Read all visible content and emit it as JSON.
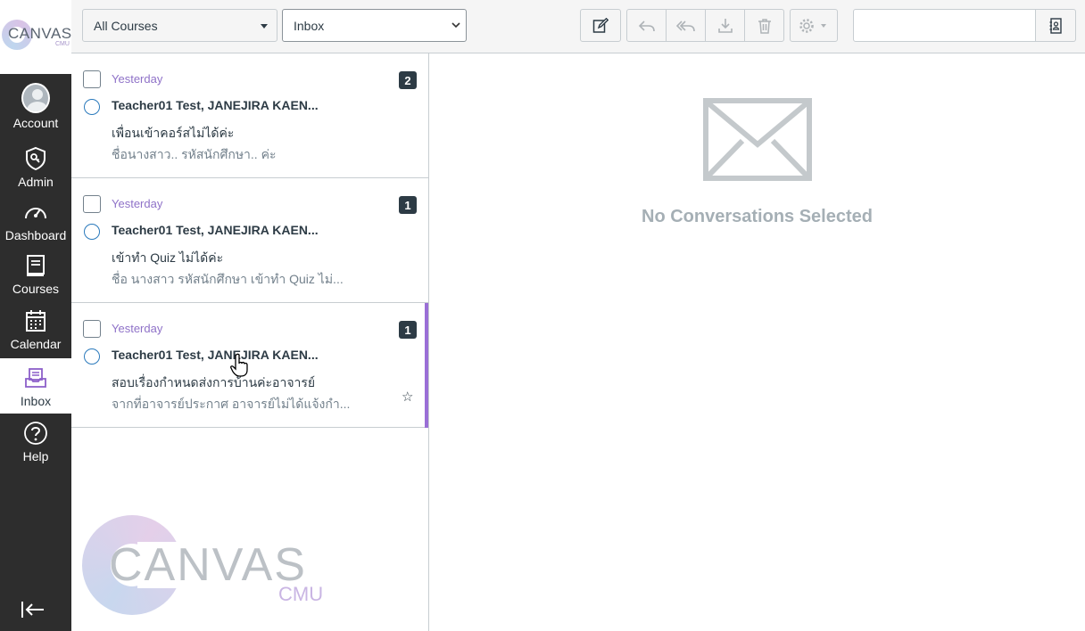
{
  "brand": {
    "logo_text": "CANVAS",
    "logo_sub": "CMU"
  },
  "global_nav": {
    "items": [
      {
        "label": "Account",
        "icon": "avatar"
      },
      {
        "label": "Admin",
        "icon": "shield-icon"
      },
      {
        "label": "Dashboard",
        "icon": "speedometer-icon"
      },
      {
        "label": "Courses",
        "icon": "book-icon"
      },
      {
        "label": "Calendar",
        "icon": "calendar-icon"
      },
      {
        "label": "Inbox",
        "icon": "inbox-icon",
        "active": true
      },
      {
        "label": "Help",
        "icon": "help-icon"
      }
    ],
    "collapse_icon": "collapse-arrow-icon"
  },
  "toolbar": {
    "course_filter": "All Courses",
    "mailbox_filter": "Inbox",
    "buttons": [
      "compose-icon",
      "reply-icon",
      "reply-all-icon",
      "archive-icon",
      "trash-icon",
      "settings-icon"
    ],
    "search": {
      "value": "",
      "placeholder": ""
    }
  },
  "conversations": [
    {
      "date": "Yesterday",
      "count": "2",
      "from": "Teacher01 Test, JANEJIRA KAEN...",
      "subject": "เพื่อนเข้าคอร์สไม่ได้ค่ะ",
      "preview": "ชื่อนางสาว.. รหัสนักศึกษา.. ค่ะ",
      "selected": false,
      "starred": false
    },
    {
      "date": "Yesterday",
      "count": "1",
      "from": "Teacher01 Test, JANEJIRA KAEN...",
      "subject": "เข้าทำ Quiz ไม่ได้ค่ะ",
      "preview": "ชื่อ นางสาว รหัสนักศึกษา เข้าทำ Quiz ไม่...",
      "selected": false,
      "starred": false
    },
    {
      "date": "Yesterday",
      "count": "1",
      "from": "Teacher01 Test, JANEJIRA KAEN...",
      "subject": "สอบเรื่องกำหนดส่งการบ้านค่ะอาจารย์",
      "preview": "จากที่อาจารย์ประกาศ อาจารย์ไม่ได้แจ้งกำ...",
      "selected": true,
      "starred": false,
      "star_glyph": "☆"
    }
  ],
  "watermark": {
    "text": "CANVAS",
    "sub": "CMU"
  },
  "detail": {
    "empty_message": "No Conversations Selected",
    "empty_icon": "envelope-icon"
  },
  "colors": {
    "nav_bg": "#2d2d2d",
    "accent_purple": "#9a6fd6",
    "date_purple": "#8f72c8",
    "unread_blue": "#2b7abc"
  }
}
